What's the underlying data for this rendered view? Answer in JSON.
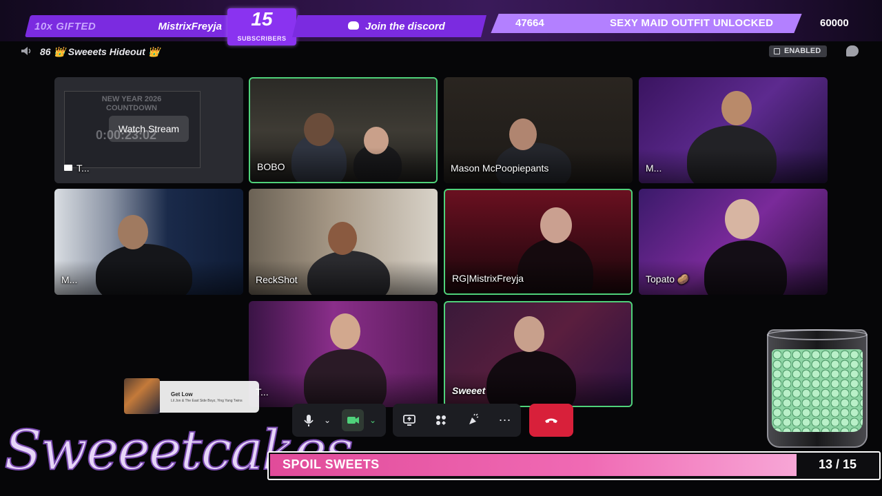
{
  "overlay": {
    "gifted_label": "10x GIFTED",
    "gifted_name": "MistrixFreyja",
    "subscribers_count": "15",
    "subscribers_label": "SUBSCRIBERS",
    "discord_label": "Join the discord",
    "goal_current": "47664",
    "goal_title": "SEXY MAID OUTFIT UNLOCKED",
    "goal_target": "60000"
  },
  "header": {
    "channel_prefix": "86 👑",
    "channel_name": "Sweeets Hideout",
    "channel_suffix": "👑",
    "enabled_label": "ENABLED"
  },
  "tiles": {
    "stream": {
      "name": "T...",
      "watch_label": "Watch Stream",
      "countdown_title": "NEW YEAR 2026\nCOUNTDOWN",
      "countdown_time": "0:00:23:02"
    },
    "bobo": {
      "name": "BOBO"
    },
    "mason": {
      "name": "Mason McPoopiepants"
    },
    "m1": {
      "name": "M..."
    },
    "m2": {
      "name": "M..."
    },
    "reckshot": {
      "name": "ReckShot"
    },
    "freyja": {
      "name": "RG|MistrixFreyja"
    },
    "topato": {
      "name": "Topato 🥔"
    },
    "t2": {
      "name": "T..."
    },
    "sweeet": {
      "name": "Sweeet"
    }
  },
  "now_playing": {
    "title": "Get Low",
    "artist": "Lil Jon & The East Side Boyz, Ying Yang Twins"
  },
  "controls": {
    "mic_icon": "microphone-icon",
    "camera_icon": "camera-icon",
    "share_icon": "screen-share-icon",
    "activities_icon": "activities-icon",
    "soundboard_icon": "soundboard-icon",
    "more_icon": "more-icon",
    "hangup_icon": "hangup-icon",
    "hangup_color": "#d8203a"
  },
  "brand": {
    "name": "Sweeetcakes"
  },
  "spoil": {
    "label": "SPOIL SWEETS",
    "current": 13,
    "target": 15,
    "count_text": "13 / 15"
  },
  "colors": {
    "accent_purple": "#7b2be0",
    "speaking_green": "#4fd27a",
    "spoil_pink": "#f06ab4"
  }
}
